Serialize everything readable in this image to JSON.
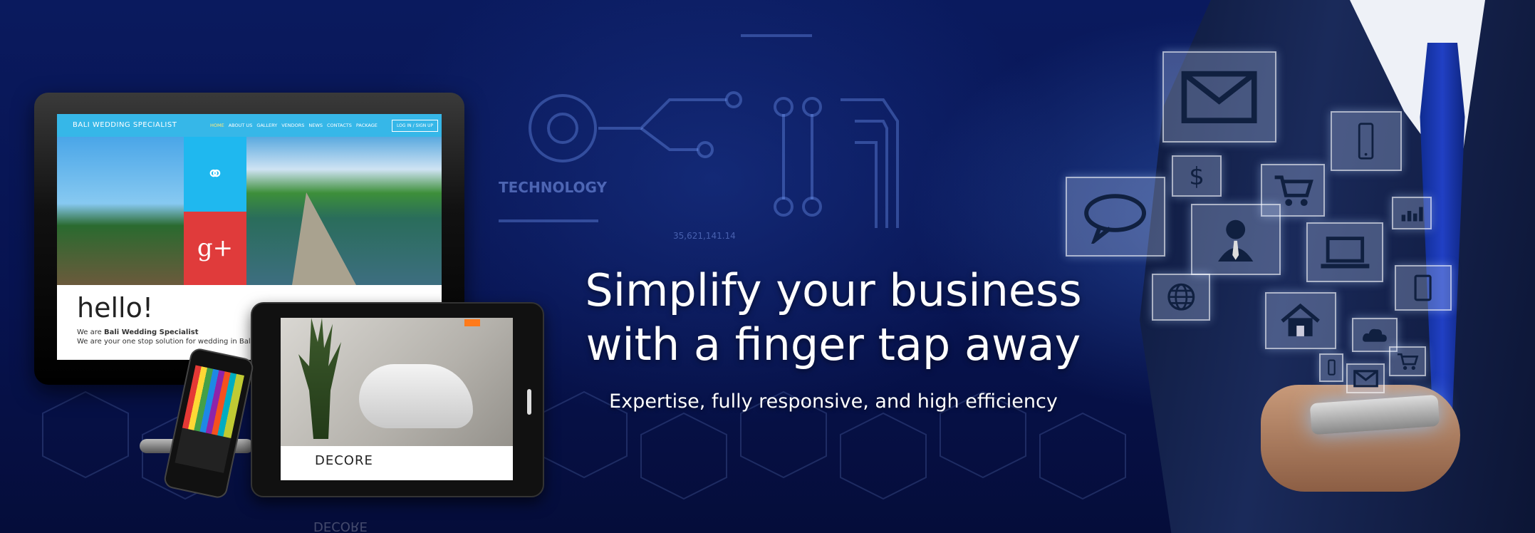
{
  "headline": {
    "line1": "Simplify your business",
    "line2": "with a finger tap away",
    "subtitle": "Expertise, fully responsive, and high efficiency"
  },
  "circuit": {
    "technology_label": "TECHNOLOGY",
    "code": "35,621,141.14"
  },
  "monitor_site": {
    "logo": "BALI WEDDING SPECIALIST",
    "nav": [
      "HOME",
      "ABOUT US",
      "GALLERY",
      "VENDORS",
      "NEWS",
      "CONTACTS",
      "PACKAGE"
    ],
    "login": "LOG IN / SIGN UP",
    "hello": "hello!",
    "line1_prefix": "We are ",
    "line1_bold": "Bali Wedding Specialist",
    "line2": "We are your one stop solution for wedding in Bali."
  },
  "tablet_site": {
    "brand": "DECORE"
  },
  "reflection": {
    "brand": "DECORE"
  },
  "icons": [
    "envelope-icon",
    "dollar-icon",
    "smartphone-icon",
    "cart-icon",
    "chat-icon",
    "person-icon",
    "bar-chart-icon",
    "laptop-icon",
    "globe-icon",
    "home-icon",
    "cloud-icon",
    "tablet-icon",
    "mail-icon",
    "cart-small-icon",
    "mobile-small-icon"
  ],
  "colors": {
    "background": "#071350",
    "site_header": "#36b7e8",
    "tile_blue": "#1fb8ef",
    "tile_red": "#e03b3b",
    "tie": "#2140c4"
  }
}
